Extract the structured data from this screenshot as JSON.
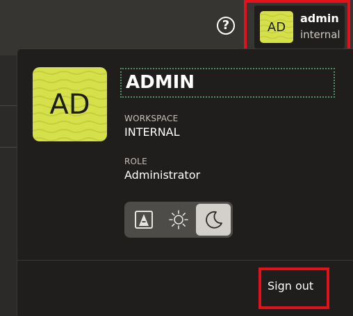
{
  "header": {
    "help_icon": "question-circle-icon",
    "help_glyph": "?",
    "user_menu": {
      "initials": "AD",
      "username": "admin",
      "workspace": "internal"
    }
  },
  "profile": {
    "initials": "AD",
    "display_name": "ADMIN",
    "workspace_label": "WORKSPACE",
    "workspace_value": "INTERNAL",
    "role_label": "ROLE",
    "role_value": "Administrator"
  },
  "theme_switcher": {
    "options": [
      {
        "icon": "auto-theme-icon"
      },
      {
        "icon": "sun-icon"
      },
      {
        "icon": "moon-icon"
      }
    ],
    "selected": "moon-icon"
  },
  "actions": {
    "sign_out_label": "Sign out"
  },
  "colors": {
    "avatar_bg": "#d5e04a",
    "highlight": "#e0121b",
    "panel_bg": "#201e1c",
    "focus_outline": "#4f8f6a"
  }
}
